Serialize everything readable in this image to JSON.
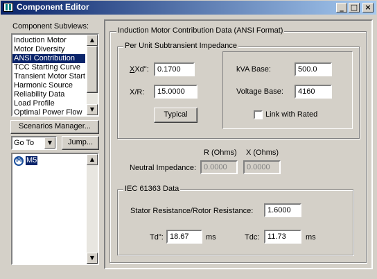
{
  "window": {
    "title": "Component Editor",
    "controls": {
      "minimize": "_",
      "maximize": "□",
      "close": "×"
    }
  },
  "subviews": {
    "label": "Component Subviews:",
    "items": [
      "Induction Motor",
      "Motor Diversity",
      "ANSI Contribution",
      "TCC Starting Curve",
      "Transient Motor Startin",
      "Harmonic Source",
      "Reliability Data",
      "Load Profile",
      "Optimal Power Flow"
    ],
    "selected": "ANSI Contribution"
  },
  "scenarios_button": "Scenarios Manager...",
  "goto": {
    "value": "Go To",
    "jump_label": "Jump..."
  },
  "tree": {
    "item": "M5"
  },
  "main_group": {
    "title": "Induction Motor Contribution Data (ANSI Format)"
  },
  "impedance": {
    "title": "Per Unit Subtransient Impedance",
    "xd_label": "Xd\":",
    "xd_value": "0.1700",
    "xr_label": "X/R:",
    "xr_value": "15.0000",
    "typical_label": "Typical",
    "kva_label": "kVA Base:",
    "kva_value": "500.0",
    "voltage_label": "Voltage Base:",
    "voltage_value": "4160",
    "link_label": "Link with Rated",
    "link_checked": false
  },
  "neutral": {
    "r_header": "R (Ohms)",
    "x_header": "X (Ohms)",
    "label": "Neutral Impedance:",
    "r_value": "0.0000",
    "x_value": "0.0000"
  },
  "iec": {
    "title": "IEC 61363 Data",
    "ratio_label": "Stator Resistance/Rotor Resistance:",
    "ratio_value": "1.6000",
    "td_label": "Td\":",
    "td_value": "18.67",
    "td_unit": "ms",
    "tdc_label": "Tdc:",
    "tdc_value": "11.73",
    "tdc_unit": "ms"
  }
}
